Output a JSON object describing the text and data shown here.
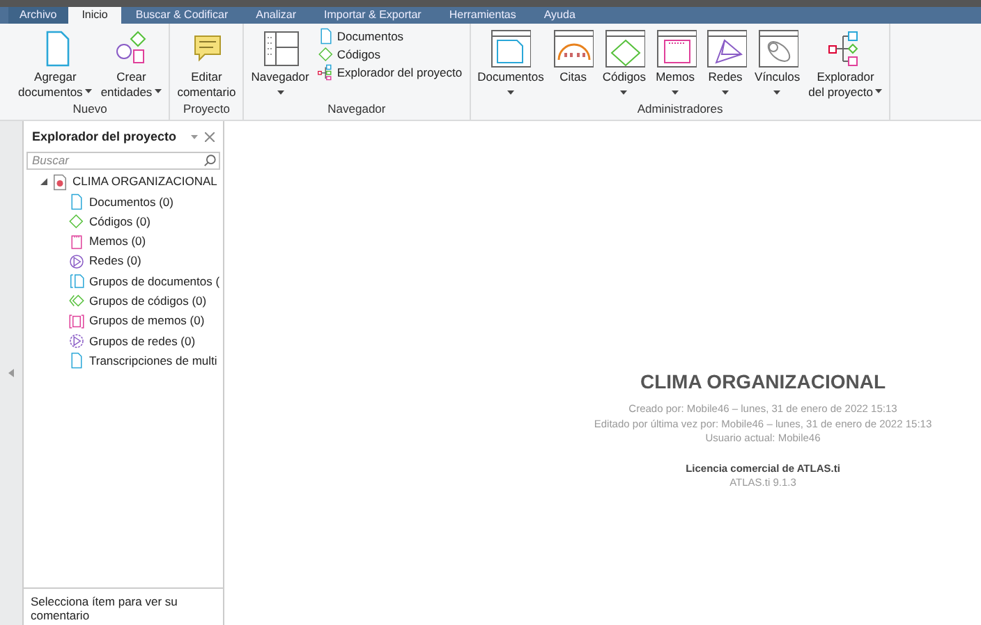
{
  "menu_tabs": [
    {
      "label": "Archivo",
      "kind": "file",
      "selected": false
    },
    {
      "label": "Inicio",
      "kind": "tab",
      "selected": true
    },
    {
      "label": "Buscar & Codificar",
      "kind": "tab",
      "selected": false
    },
    {
      "label": "Analizar",
      "kind": "tab",
      "selected": false
    },
    {
      "label": "Importar & Exportar",
      "kind": "tab",
      "selected": false
    },
    {
      "label": "Herramientas",
      "kind": "tab",
      "selected": false
    },
    {
      "label": "Ayuda",
      "kind": "tab",
      "selected": false
    }
  ],
  "ribbon_groups": [
    {
      "title": "Nuevo",
      "buttons": [
        {
          "kind": "doc",
          "label": [
            "Agregar",
            "documentos"
          ],
          "dropdown": true
        },
        {
          "kind": "entities",
          "label": [
            "Crear",
            "entidades"
          ],
          "dropdown": true
        }
      ]
    },
    {
      "title": "Proyecto",
      "buttons": [
        {
          "kind": "comment",
          "label": [
            "Editar",
            "comentario"
          ],
          "dropdown": false
        }
      ]
    },
    {
      "title": "Navegador",
      "buttons": [
        {
          "kind": "navigator",
          "label": [
            "Navegador"
          ],
          "dropdown": true
        }
      ],
      "small_buttons": [
        {
          "kind": "doc",
          "label": "Documentos"
        },
        {
          "kind": "code",
          "label": "Códigos"
        },
        {
          "kind": "explorer",
          "label": "Explorador del proyecto"
        }
      ]
    },
    {
      "title": "Administradores",
      "buttons": [
        {
          "kind": "mgr-doc",
          "label": [
            "Documentos"
          ],
          "dropdown": true
        },
        {
          "kind": "mgr-quote",
          "label": [
            "Citas"
          ],
          "dropdown": false
        },
        {
          "kind": "mgr-code",
          "label": [
            "Códigos"
          ],
          "dropdown": true
        },
        {
          "kind": "mgr-memo",
          "label": [
            "Memos"
          ],
          "dropdown": true
        },
        {
          "kind": "mgr-net",
          "label": [
            "Redes"
          ],
          "dropdown": true
        },
        {
          "kind": "mgr-link",
          "label": [
            "Vínculos"
          ],
          "dropdown": true
        },
        {
          "kind": "explorer",
          "label": [
            "Explorador",
            "del proyecto"
          ],
          "dropdown": true
        }
      ]
    }
  ],
  "explorer_panel": {
    "title": "Explorador del proyecto",
    "search": {
      "placeholder": "Buscar"
    },
    "tree": [
      {
        "label": "CLIMA ORGANIZACIONAL",
        "kind": "project",
        "expanded": true,
        "children": [
          {
            "label": "Documentos (0)",
            "kind": "doc"
          },
          {
            "label": "Códigos (0)",
            "kind": "code"
          },
          {
            "label": "Memos (0)",
            "kind": "memo"
          },
          {
            "label": "Redes (0)",
            "kind": "net"
          },
          {
            "label": "Grupos de documentos (",
            "kind": "docgroup"
          },
          {
            "label": "Grupos de códigos (0)",
            "kind": "codegroup"
          },
          {
            "label": "Grupos de memos (0)",
            "kind": "memogroup"
          },
          {
            "label": "Grupos de redes (0)",
            "kind": "netgroup"
          },
          {
            "label": "Transcripciones de multi",
            "kind": "doc"
          }
        ]
      }
    ],
    "comment_hint": "Selecciona ítem para ver su comentario"
  },
  "project_info": {
    "title": "CLIMA ORGANIZACIONAL",
    "lines": [
      "Creado por:  Mobile46 – lunes, 31 de enero de 2022 15:13",
      "Editado por última vez por:  Mobile46 – lunes, 31 de enero de 2022 15:13",
      "Usuario actual:  Mobile46"
    ],
    "license": "Licencia comercial de ATLAS.ti",
    "version": "ATLAS.ti 9.1.3"
  }
}
